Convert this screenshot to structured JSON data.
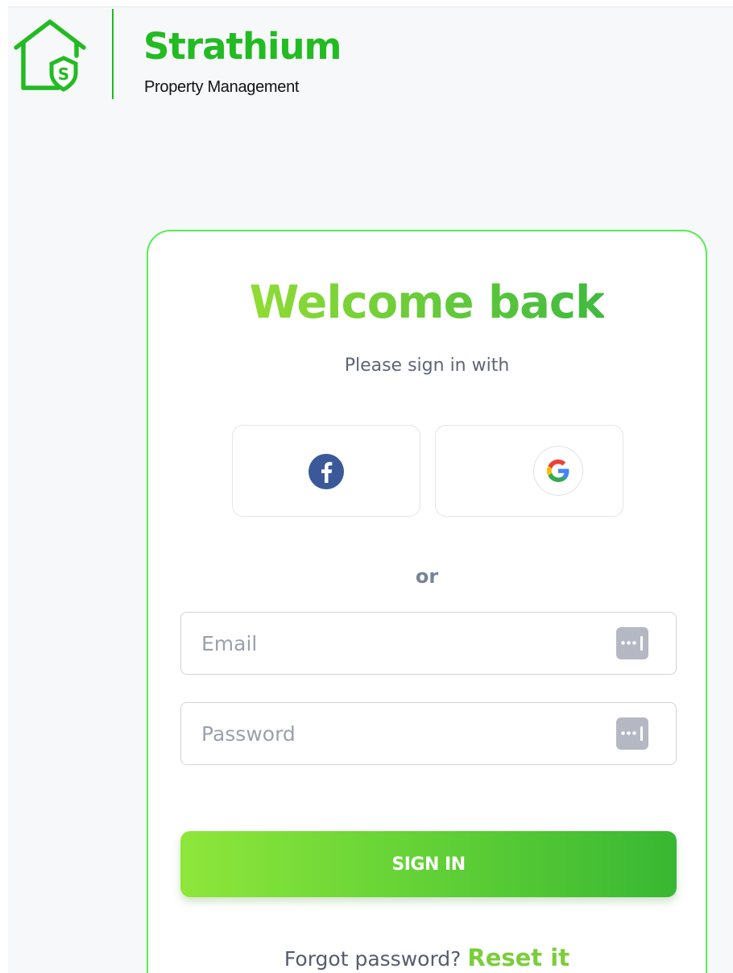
{
  "brand": {
    "name": "Strathium",
    "tagline": "Property Management",
    "logo_icon": "house-shield-icon",
    "logo_letter": "S",
    "color": "#22bb22"
  },
  "login": {
    "title": "Welcome back",
    "subtitle": "Please sign in with",
    "social": [
      {
        "provider": "facebook",
        "icon": "facebook-icon"
      },
      {
        "provider": "google",
        "icon": "google-icon"
      }
    ],
    "divider_text": "or",
    "email": {
      "value": "",
      "placeholder": "Email",
      "icon": "password-manager-key-icon"
    },
    "password": {
      "value": "",
      "placeholder": "Password",
      "icon": "password-manager-key-icon"
    },
    "submit_label": "SIGN IN",
    "forgot_text": "Forgot password?",
    "reset_link": "Reset it"
  },
  "colors": {
    "accent": "#6fcf3a",
    "card_border": "#55ee55",
    "button_gradient_start": "#8ee63a",
    "button_gradient_end": "#38b733",
    "facebook_blue": "#3b5998"
  }
}
